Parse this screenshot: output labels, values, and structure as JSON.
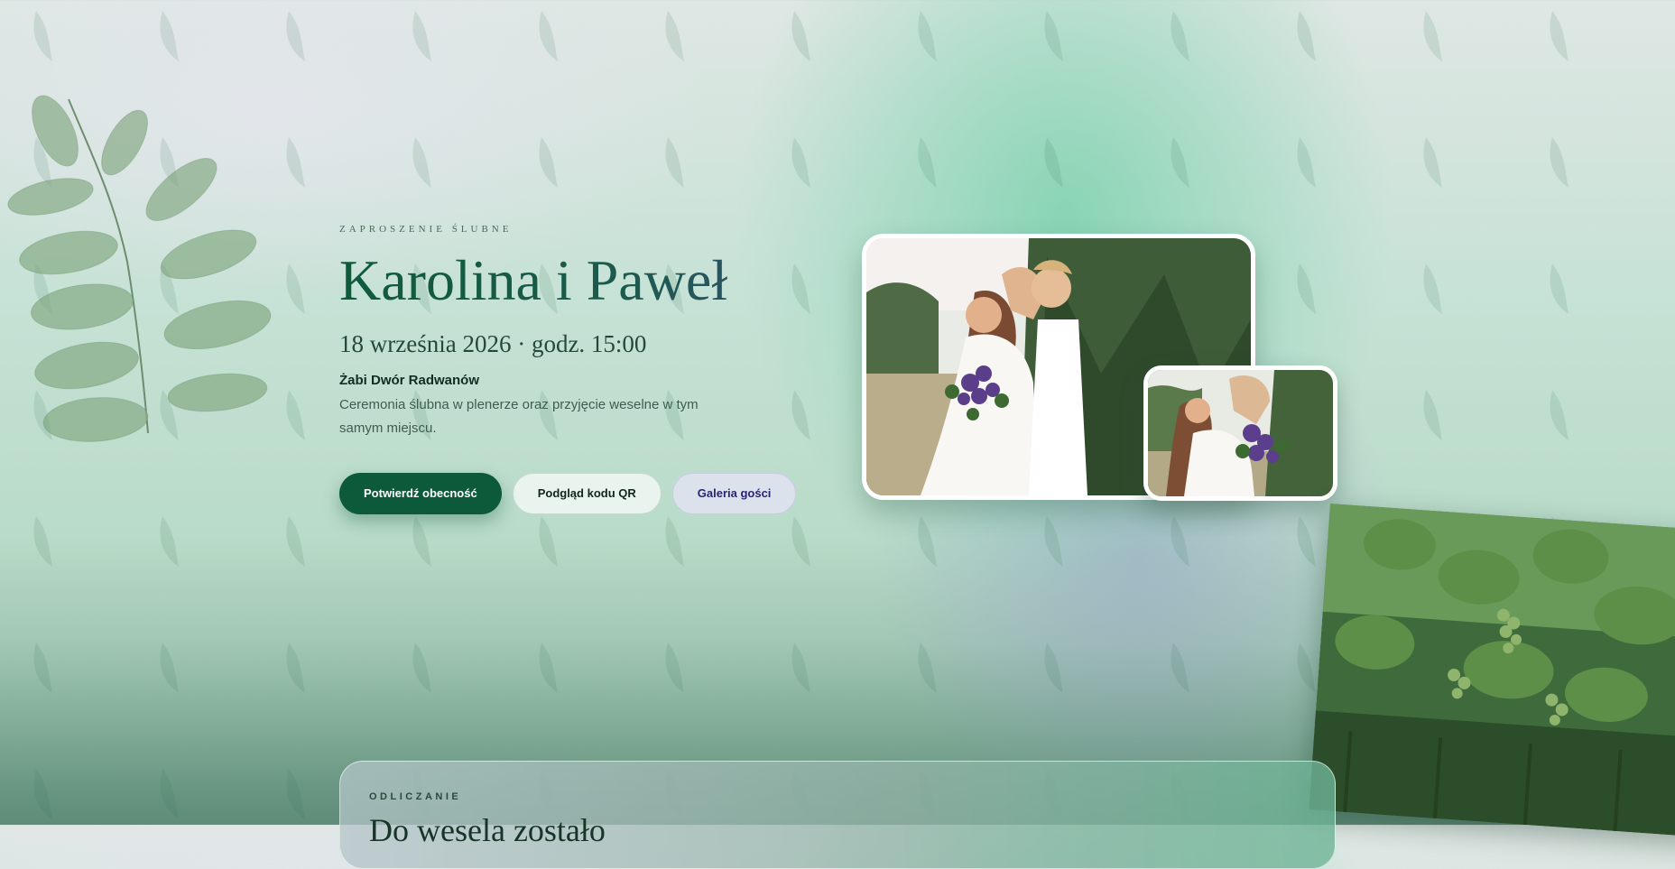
{
  "hero": {
    "eyebrow": "ZAPROSZENIE ŚLUBNE",
    "title": "Karolina i Paweł",
    "date_time": "18 września 2026 · godz. 15:00",
    "venue": "Żabi Dwór Radwanów",
    "description": "Ceremonia ślubna w plenerze oraz przyjęcie weselne w tym samym miejscu.",
    "buttons": {
      "rsvp": "Potwierdź obecność",
      "qr_preview": "Podgląd kodu QR",
      "guest_gallery": "Galeria gości"
    }
  },
  "countdown": {
    "label": "ODLICZANIE",
    "heading": "Do wesela zostało"
  },
  "colors": {
    "primary": "#0d5a3a",
    "title_gradient_start": "#0f5a3c",
    "title_gradient_end": "#2e4f74",
    "guest_gallery_text": "#2a2470"
  },
  "icons": [
    "leaf-branch-icon",
    "leaf-pattern-icon"
  ]
}
